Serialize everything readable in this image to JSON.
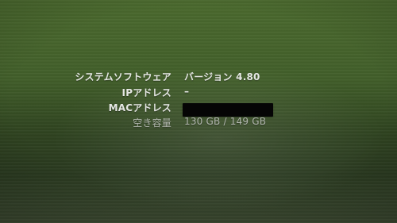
{
  "system_info": {
    "rows": [
      {
        "label": "システムソフトウェア",
        "value": "バージョン 4.80"
      },
      {
        "label": "IPアドレス",
        "value": "–"
      },
      {
        "label": "MACアドレス",
        "value": ""
      },
      {
        "label": "空き容量",
        "value": "130 GB / 149 GB"
      }
    ]
  },
  "colors": {
    "background_top": "#4b6a2e",
    "background_bottom": "#2a3a20",
    "text": "#f5f5f5",
    "redaction": "#050505"
  }
}
